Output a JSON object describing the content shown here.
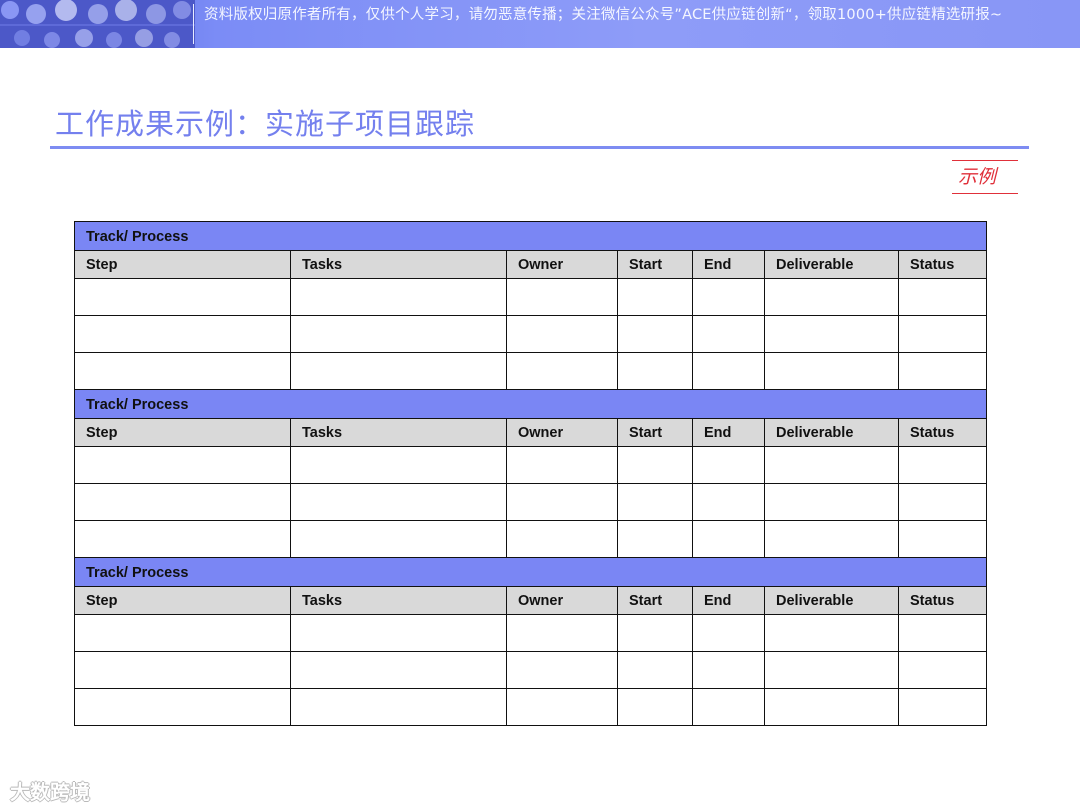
{
  "banner": {
    "notice": "资料版权归原作者所有，仅供个人学习，请勿恶意传播；关注微信公众号”ACE供应链创新“，领取1000+供应链精选研报~"
  },
  "title": "工作成果示例：实施子项目跟踪",
  "sample_tag": "示例",
  "table": {
    "columns": [
      "Step",
      "Tasks",
      "Owner",
      "Start",
      "End",
      "Deliverable",
      "Status"
    ],
    "tracks": [
      {
        "label": "Track/ Process",
        "rows": [
          [
            "",
            "",
            "",
            "",
            "",
            "",
            ""
          ],
          [
            "",
            "",
            "",
            "",
            "",
            "",
            ""
          ],
          [
            "",
            "",
            "",
            "",
            "",
            "",
            ""
          ]
        ]
      },
      {
        "label": "Track/ Process",
        "rows": [
          [
            "",
            "",
            "",
            "",
            "",
            "",
            ""
          ],
          [
            "",
            "",
            "",
            "",
            "",
            "",
            ""
          ],
          [
            "",
            "",
            "",
            "",
            "",
            "",
            ""
          ]
        ]
      },
      {
        "label": "Track/ Process",
        "rows": [
          [
            "",
            "",
            "",
            "",
            "",
            "",
            ""
          ],
          [
            "",
            "",
            "",
            "",
            "",
            "",
            ""
          ],
          [
            "",
            "",
            "",
            "",
            "",
            "",
            ""
          ]
        ]
      }
    ]
  },
  "watermark": "大数跨境",
  "colors": {
    "banner": "#8e9cf8",
    "title": "#7480ee",
    "track_header": "#7a86f4",
    "column_header": "#d9d9d9",
    "sample_tag": "#e0303a"
  }
}
